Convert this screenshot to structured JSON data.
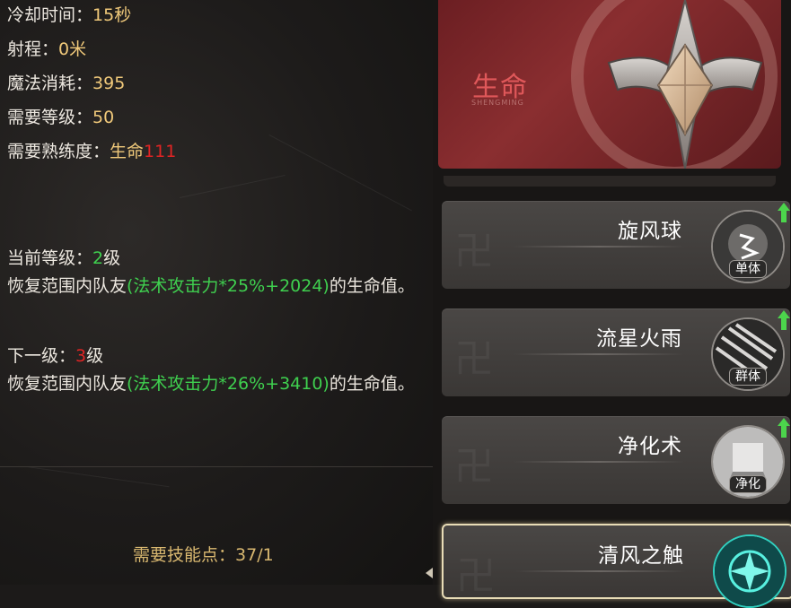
{
  "stats": {
    "cooldown_label": "冷却时间：",
    "cooldown_value": "15秒",
    "range_label": "射程：",
    "range_value": "0米",
    "mana_label": "魔法消耗：",
    "mana_value": "395",
    "level_label": "需要等级：",
    "level_value": "50",
    "prof_label": "需要熟练度：",
    "prof_school": "生命",
    "prof_value": "111"
  },
  "current": {
    "label": "当前等级：",
    "level": "2",
    "level_unit": "级",
    "desc_pre": "恢复范围内队友",
    "desc_formula": "(法术攻击力*25%+2024)",
    "desc_post": "的生命值。"
  },
  "next": {
    "label": "下一级：",
    "level": "3",
    "level_unit": "级",
    "desc_pre": "恢复范围内队友",
    "desc_formula": "(法术攻击力*26%+3410)",
    "desc_post": "的生命值。"
  },
  "footer": {
    "label": "需要技能点：",
    "value": "37/1"
  },
  "banner": {
    "title": "生命",
    "subtitle": "SHENGMING"
  },
  "skills": [
    {
      "name": "旋风球",
      "tag": "单体"
    },
    {
      "name": "流星火雨",
      "tag": "群体"
    },
    {
      "name": "净化术",
      "tag": "净化"
    },
    {
      "name": "清风之触",
      "tag": ""
    }
  ],
  "colors": {
    "value": "#f0c97a",
    "red": "#e02424",
    "green": "#3fd04f",
    "banner": "#8a2e30"
  }
}
